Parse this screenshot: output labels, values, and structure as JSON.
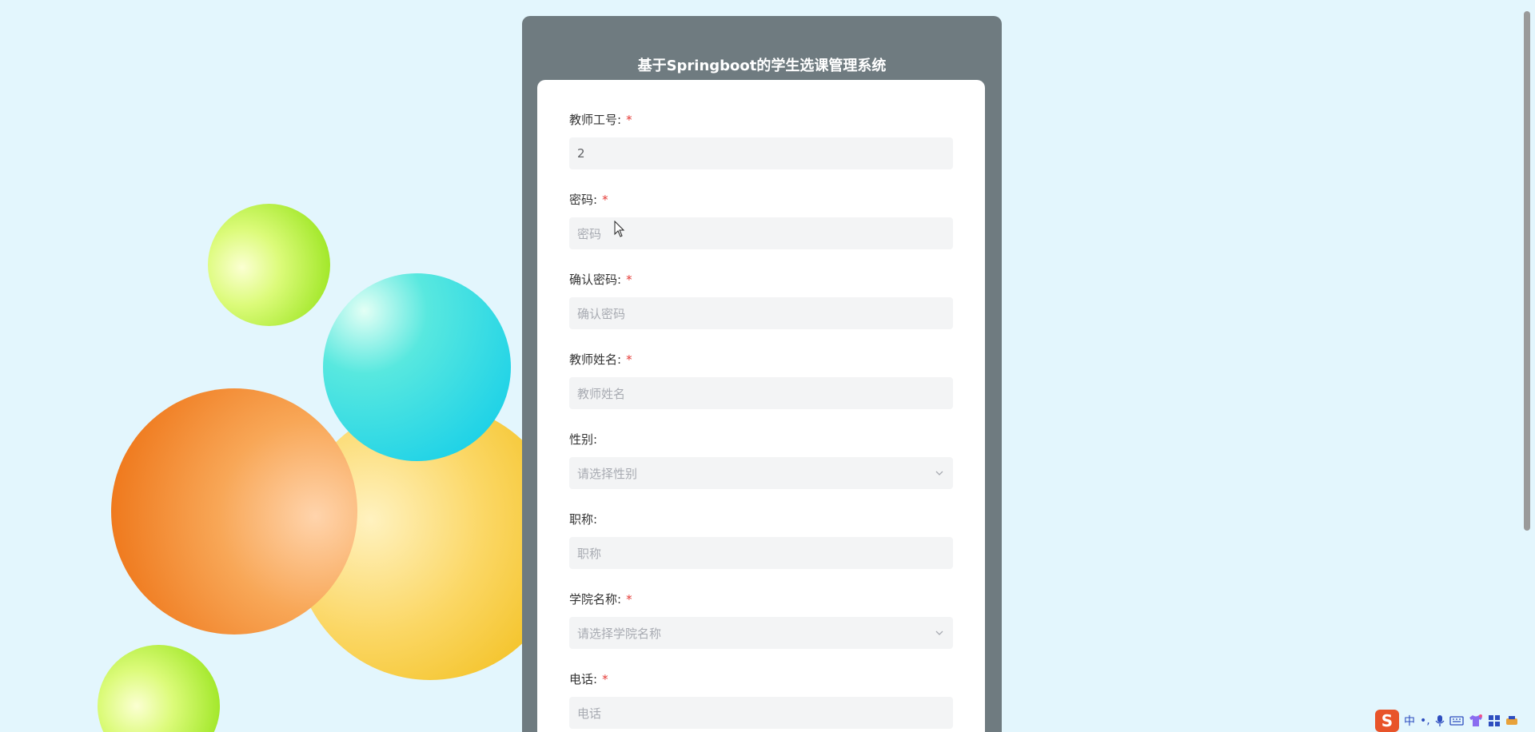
{
  "header": {
    "title": "基于Springboot的学生选课管理系统"
  },
  "form": {
    "fields": [
      {
        "label": "教师工号:",
        "required": true,
        "value": "2",
        "placeholder": "",
        "type": "input"
      },
      {
        "label": "密码:",
        "required": true,
        "value": "",
        "placeholder": "密码",
        "type": "input"
      },
      {
        "label": "确认密码:",
        "required": true,
        "value": "",
        "placeholder": "确认密码",
        "type": "input"
      },
      {
        "label": "教师姓名:",
        "required": true,
        "value": "",
        "placeholder": "教师姓名",
        "type": "input"
      },
      {
        "label": "性别:",
        "required": false,
        "value": "",
        "placeholder": "请选择性别",
        "type": "select"
      },
      {
        "label": "职称:",
        "required": false,
        "value": "",
        "placeholder": "职称",
        "type": "input"
      },
      {
        "label": "学院名称:",
        "required": true,
        "value": "",
        "placeholder": "请选择学院名称",
        "type": "select"
      },
      {
        "label": "电话:",
        "required": true,
        "value": "",
        "placeholder": "电话",
        "type": "input"
      }
    ],
    "required_mark": "*"
  },
  "tray": {
    "ime_logo": "S",
    "ime_lang": "中",
    "punct": "•,",
    "icons": [
      "mic-icon",
      "keyboard-icon",
      "shirt-icon",
      "grid-icon",
      "tool-icon"
    ]
  },
  "colors": {
    "background": "#e3f6fd",
    "panel": "#6f7b80",
    "required": "#e53935"
  }
}
